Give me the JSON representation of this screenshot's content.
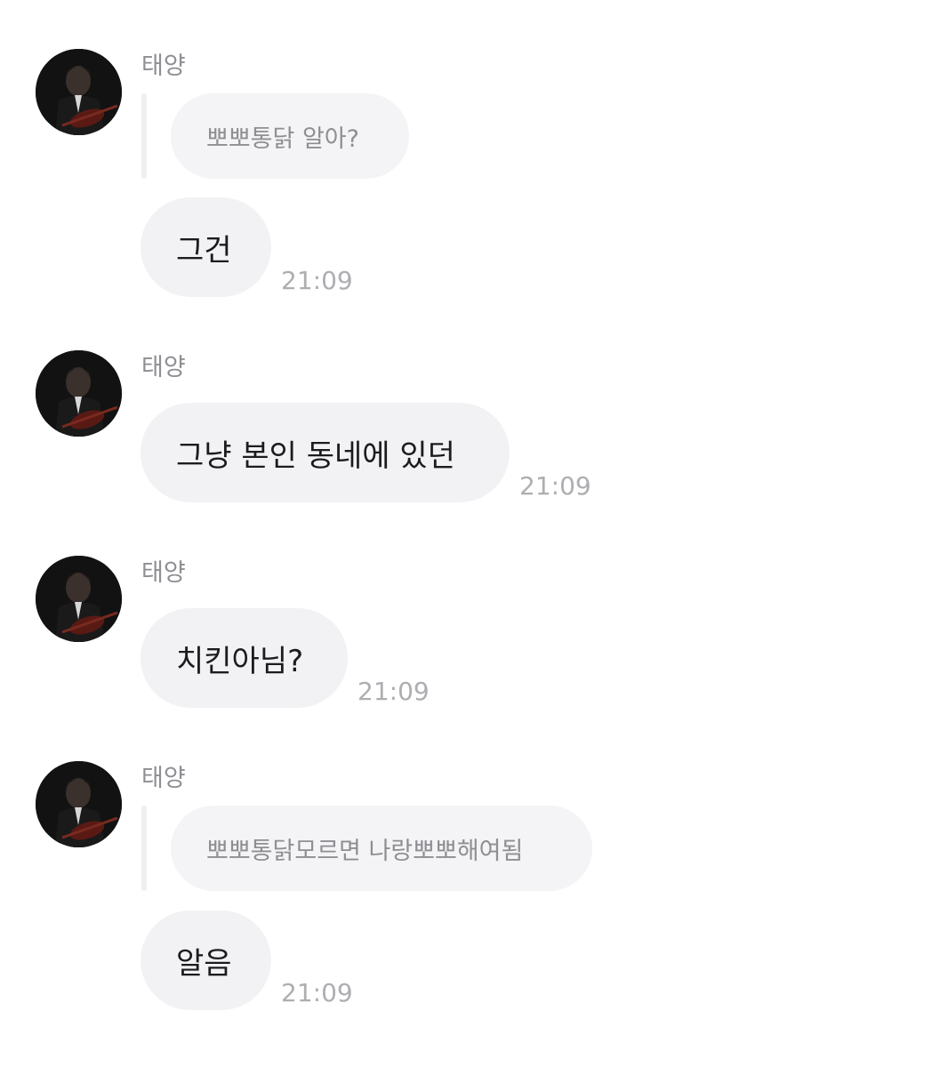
{
  "messages": [
    {
      "sender": "태양",
      "quote": "뽀뽀통닭 알아?",
      "text": "그건",
      "time": "21:09"
    },
    {
      "sender": "태양",
      "text": "그냥 본인 동네에 있던",
      "time": "21:09"
    },
    {
      "sender": "태양",
      "text": "치킨아님?",
      "time": "21:09"
    },
    {
      "sender": "태양",
      "quote": "뽀뽀통닭모르면 나랑뽀뽀해여됨",
      "text": "알음",
      "time": "21:09"
    }
  ],
  "colors": {
    "bubble": "#f2f2f4",
    "quote_bubble": "#f4f4f6",
    "sender_text": "#8e8e93",
    "time_text": "#aeaeb2",
    "message_text": "#1c1c1e"
  }
}
